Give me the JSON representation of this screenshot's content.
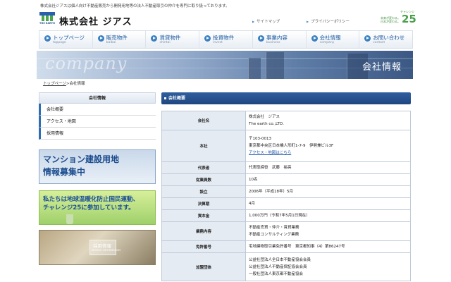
{
  "header": {
    "tagline": "株式会社ジアスは個人向け不動産販売から開発用地等の法人不動産取引の仲介を専門に取り扱っております。",
    "logo_caption": "THE EARTH",
    "company_name": "株式会社 ジアス",
    "links": [
      {
        "label": "サイトマップ"
      },
      {
        "label": "プライバシーポリシー"
      }
    ],
    "challenge": {
      "label": "チャレンジ",
      "number": "25",
      "line1": "未来が変わる。",
      "line2": "日本が変わる。"
    }
  },
  "nav": [
    {
      "jp": "トップページ",
      "en": "toppage"
    },
    {
      "jp": "販売物件",
      "en": "baibai"
    },
    {
      "jp": "賃貸物件",
      "en": "chintai"
    },
    {
      "jp": "投資物件",
      "en": "invest"
    },
    {
      "jp": "事業内容",
      "en": "business"
    },
    {
      "jp": "会社情報",
      "en": "company"
    },
    {
      "jp": "お問い合わせ",
      "en": "contact"
    }
  ],
  "hero": {
    "word": "company",
    "title": "会社情報"
  },
  "breadcrumb": {
    "home": "トップページ",
    "sep": ">",
    "current": "会社情報"
  },
  "sidebar": {
    "heading": "会社情報",
    "items": [
      {
        "label": "会社概要"
      },
      {
        "label": "アクセス・地図"
      },
      {
        "label": "採用情報"
      }
    ]
  },
  "banners": {
    "mansion": {
      "line1": "マンション建設用地",
      "line2": "情報募集中"
    },
    "challenge25": {
      "line1": "私たちは地球温暖化防止国民運動、",
      "line2": "チャレンジ25に参加しています。"
    },
    "recruit": {
      "title": "採用情報",
      "subtitle": "RECRUIT INFORMATION"
    }
  },
  "main": {
    "section_title": "会社概要",
    "rows": [
      {
        "label": "会社名",
        "lines": [
          "株式会社　ジアス",
          "The earth co.,LTD."
        ]
      },
      {
        "label": "本社",
        "lines": [
          "〒103-0013",
          "東京都中央区日本橋人形町1-7-9　伊勢兼ビル3F"
        ],
        "link": "アクセス・地図はこちら"
      },
      {
        "label": "代表者",
        "lines": [
          "代表取締役　武藤　裕亮"
        ]
      },
      {
        "label": "従業員数",
        "lines": [
          "10名"
        ]
      },
      {
        "label": "設立",
        "lines": [
          "2006年（平成18年）5月"
        ]
      },
      {
        "label": "決算期",
        "lines": [
          "4月"
        ]
      },
      {
        "label": "資本金",
        "lines": [
          "1,000万円（令和7年5月1日現在）"
        ]
      },
      {
        "label": "業務内容",
        "lines": [
          "不動産売買・仲介・賃貸業務",
          "不動産コンサルティング業務"
        ]
      },
      {
        "label": "免許番号",
        "lines": [
          "宅地建物取引業免許番号　東京都知事（4）第86247号"
        ]
      },
      {
        "label": "加盟団体",
        "lines": [
          "公益社団法人全日本不動産協会会員",
          "公益社団法人不動産保証協会会員",
          "一般社団法人東京都不動産協会"
        ]
      }
    ]
  },
  "colors": {
    "brand_blue": "#1f4681",
    "nav_text": "#1c5aa0",
    "table_header_bg": "#e4ebf3",
    "challenge_green": "#4aa04a"
  },
  "icons": [
    "logo-mark",
    "triangle-bullet-icon",
    "circle-arrow-icon"
  ]
}
